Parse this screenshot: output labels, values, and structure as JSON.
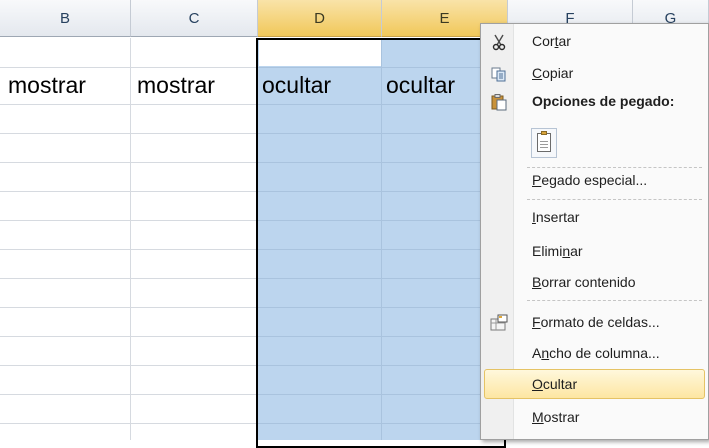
{
  "columns": [
    "B",
    "C",
    "D",
    "E",
    "F",
    "G"
  ],
  "cells": {
    "B": "mostrar",
    "C": "mostrar",
    "D": "ocultar",
    "E": "ocultar"
  },
  "menu": {
    "cut": {
      "pre": "Cor",
      "key": "t",
      "post": "ar"
    },
    "copy": {
      "pre": "",
      "key": "C",
      "post": "opiar"
    },
    "paste_options": "Opciones de pegado:",
    "paste_special": {
      "pre": "",
      "key": "P",
      "post": "egado especial..."
    },
    "insert": {
      "pre": "",
      "key": "I",
      "post": "nsertar"
    },
    "delete": {
      "pre": "Elimi",
      "key": "n",
      "post": "ar"
    },
    "clear": {
      "pre": "",
      "key": "B",
      "post": "orrar contenido"
    },
    "format_cells": {
      "pre": "",
      "key": "F",
      "post": "ormato de celdas..."
    },
    "col_width": {
      "pre": "A",
      "key": "n",
      "post": "cho de columna..."
    },
    "hide": {
      "pre": "",
      "key": "O",
      "post": "cultar"
    },
    "unhide": {
      "pre": "",
      "key": "M",
      "post": "ostrar"
    }
  },
  "icons": {
    "cut": "scissors-icon",
    "copy": "copy-icon",
    "paste": "paste-icon",
    "format_cells": "format-cells-icon"
  },
  "colors": {
    "selection": "#bcd5ee",
    "header_selected": "#f1c85a",
    "menu_hover": "#fde6a2"
  }
}
